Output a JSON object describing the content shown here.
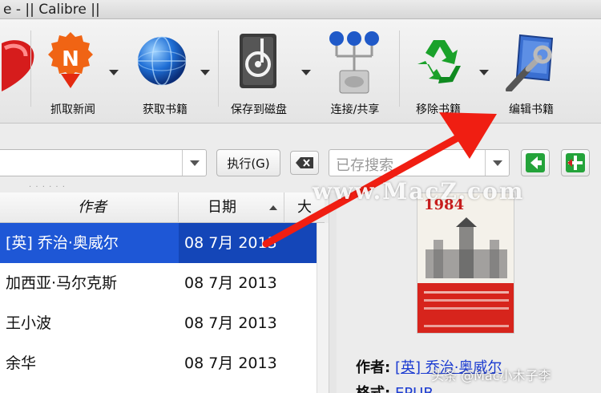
{
  "window": {
    "title": "e - || Calibre ||"
  },
  "toolbar": {
    "fetch_news": "抓取新闻",
    "get_books": "获取书籍",
    "save_to_disk": "保存到磁盘",
    "connect_share": "连接/共享",
    "remove_books": "移除书籍",
    "edit_books": "编辑书籍"
  },
  "search": {
    "execute_label": "执行(G)",
    "saved_search_placeholder": "已存搜索"
  },
  "table": {
    "columns": {
      "author": "作者",
      "date": "日期",
      "size": "大"
    },
    "rows": [
      {
        "author": "[英] 乔治·奥威尔",
        "date": "08 7月 2013"
      },
      {
        "author": "加西亚·马尔克斯",
        "date": "08 7月 2013"
      },
      {
        "author": "王小波",
        "date": "08 7月 2013"
      },
      {
        "author": "余华",
        "date": "08 7月 2013"
      }
    ]
  },
  "details": {
    "cover_title": "1984",
    "author_label": "作者:",
    "author_value": "[英] 乔治·奥威尔",
    "format_label": "格式:",
    "format_value": "EPUB"
  },
  "watermark": "www.MacZ.com",
  "credit": "头条 @Mac小木子李",
  "colors": {
    "selection": "#1e57d6",
    "link": "#1b3bd1",
    "annotation_arrow": "#f01e12"
  }
}
